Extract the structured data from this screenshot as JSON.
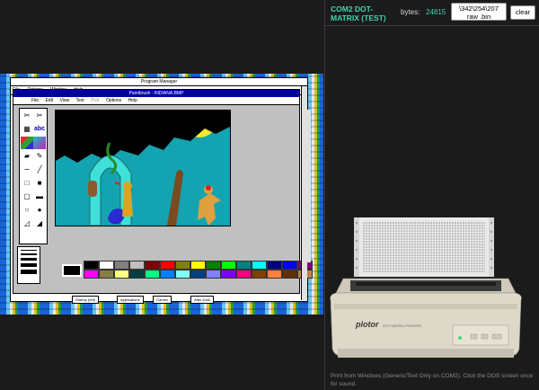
{
  "screen": {
    "program_manager": {
      "title": "Program Manager",
      "menu": [
        "File",
        "Options",
        "Window",
        "Help"
      ],
      "tabs": [
        "Startup (left)",
        "Applications",
        "Games",
        "After Dark"
      ]
    },
    "paintbrush": {
      "title": "Paintbrush - INDIANA.BMP",
      "menu": [
        "File",
        "Edit",
        "View",
        "Text",
        "Pick",
        "Options",
        "Help"
      ],
      "tool_text_label": "abc",
      "palette": [
        "#000000",
        "#ffffff",
        "#808080",
        "#c0c0c0",
        "#800000",
        "#ff0000",
        "#808000",
        "#ffff00",
        "#008000",
        "#00ff00",
        "#008080",
        "#00ffff",
        "#000080",
        "#0000ff",
        "#800080",
        "#ff00ff",
        "#808040",
        "#ffff80",
        "#004040",
        "#00ff80",
        "#0080ff",
        "#80ffff",
        "#004080",
        "#8080ff",
        "#8000ff",
        "#ff0080",
        "#804000",
        "#ff8040",
        "#603000",
        "#c08040"
      ]
    }
  },
  "panel": {
    "title": "COM2 DOT-MATRIX (TEST)",
    "bytes_label": "bytes:",
    "bytes_value": "24815",
    "raw_button_line1": "\\342\\254\\207",
    "raw_button_line2": "raw .bin",
    "clear_label": "clear",
    "hint": "Print from Windows (Generic/Text Only on COM2). Click the DOS screen once for sound.",
    "printer_brand": "plotor",
    "printer_model": "DOT MATRIX PRINTER",
    "accent": "#3fd4ad"
  }
}
